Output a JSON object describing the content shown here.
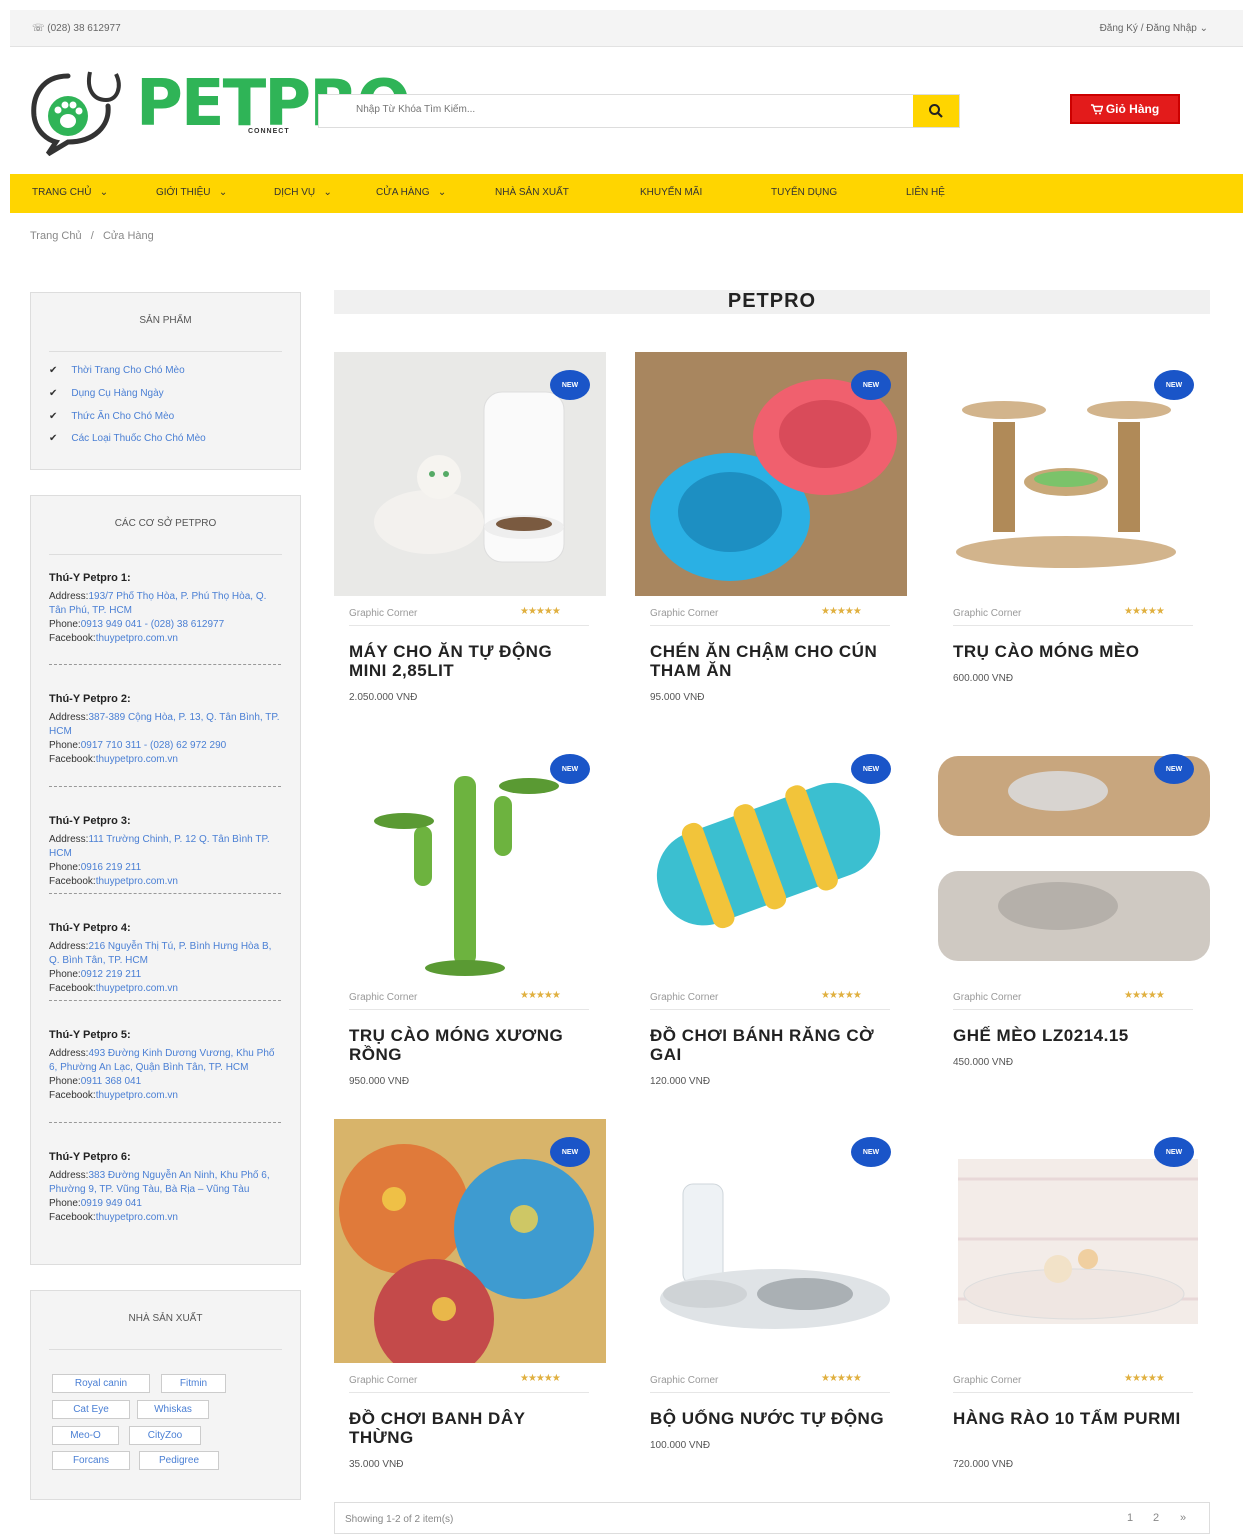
{
  "topbar": {
    "phone": "☏ (028) 38 612977",
    "auth": "Đăng Ký / Đăng Nhập ⌄"
  },
  "logo": {
    "name": "PETPRO",
    "sub": "CONNECT"
  },
  "search": {
    "placeholder": "Nhập Từ Khóa Tìm Kiếm..."
  },
  "cart": {
    "label": "Giỏ Hàng"
  },
  "nav": [
    {
      "label": "Trang Chủ",
      "dropdown": true
    },
    {
      "label": "Giới Thiệu",
      "dropdown": true
    },
    {
      "label": "Dịch Vụ",
      "dropdown": true
    },
    {
      "label": "Cửa Hàng",
      "dropdown": true
    },
    {
      "label": "Nhà Sản Xuất",
      "dropdown": false
    },
    {
      "label": "Khuyến Mãi",
      "dropdown": false
    },
    {
      "label": "Tuyển Dụng",
      "dropdown": false
    },
    {
      "label": "Liên Hệ",
      "dropdown": false
    }
  ],
  "breadcrumb": {
    "home": "Trang Chủ",
    "sep": "/",
    "current": "Cửa Hàng"
  },
  "sidebar": {
    "products_title": "Sản Phẩm",
    "categories": [
      "Thời Trang Cho Chó Mèo",
      "Dụng Cụ Hàng Ngày",
      "Thức Ăn Cho Chó Mèo",
      "Các Loại Thuốc Cho Chó Mèo"
    ],
    "branches_title": "Các Cơ Sở PETPRO",
    "labels": {
      "address": "Address:",
      "phone": "Phone:",
      "facebook": "Facebook:"
    },
    "branches": [
      {
        "name": "Thú-Y Petpro 1:",
        "address": "193/7 Phố Thọ Hòa, P. Phú Thọ Hòa, Q. Tân Phú, TP. HCM",
        "phone": "0913 949 041 - (028) 38 612977",
        "facebook": "thuypetpro.com.vn"
      },
      {
        "name": "Thú-Y Petpro 2:",
        "address": "387-389 Cộng Hòa, P. 13, Q. Tân Bình, TP. HCM",
        "phone": "0917 710 311 - (028) 62 972 290",
        "facebook": "thuypetpro.com.vn"
      },
      {
        "name": "Thú-Y Petpro 3:",
        "address": "111 Trường Chinh, P. 12 Q. Tân Bình TP. HCM",
        "phone": "0916 219 211",
        "facebook": "thuypetpro.com.vn"
      },
      {
        "name": "Thú-Y Petpro 4:",
        "address": "216 Nguyễn Thị Tú, P. Bình Hưng Hòa B, Q. Bình Tân, TP. HCM",
        "phone": "0912 219 211",
        "facebook": "thuypetpro.com.vn"
      },
      {
        "name": "Thú-Y Petpro 5:",
        "address": "493 Đường Kinh Dương Vương, Khu Phố 6, Phường An Lạc, Quận Bình Tân, TP. HCM",
        "phone": "0911 368 041",
        "facebook": "thuypetpro.com.vn"
      },
      {
        "name": "Thú-Y Petpro 6:",
        "address": "383 Đường Nguyễn An Ninh, Khu Phố 6, Phường 9, TP. Vũng Tàu, Bà Rịa – Vũng Tàu",
        "phone": "0919 949 041",
        "facebook": "thuypetpro.com.vn"
      }
    ],
    "makers_title": "Nhà Sản Xuất",
    "makers": [
      "Royal canin",
      "Fitmin",
      "Cat Eye",
      "Whiskas",
      "Meo-O",
      "CityZoo",
      "Forcans",
      "Pedigree"
    ]
  },
  "main": {
    "heading": "PETPRO",
    "badge": "NEW",
    "brand": "Graphic Corner",
    "stars": "★★★★★",
    "products": [
      {
        "name": "Máy Cho Ăn Tự Động Mini 2,85lit",
        "price": "2.050.000 VNĐ"
      },
      {
        "name": "Chén Ăn Chậm Cho Cún Tham Ăn",
        "price": "95.000 VNĐ"
      },
      {
        "name": "Trụ Cào Móng Mèo",
        "price": "600.000 VNĐ"
      },
      {
        "name": "Trụ Cào Móng Xương Rồng",
        "price": "950.000 VNĐ"
      },
      {
        "name": "Đồ Chơi Bánh Răng Cờ Gai",
        "price": "120.000 VNĐ"
      },
      {
        "name": "Ghế Mèo LZ0214.15",
        "price": "450.000 VNĐ"
      },
      {
        "name": "Đồ Chơi Banh Dây Thừng",
        "price": "35.000 VNĐ"
      },
      {
        "name": "Bộ Uống Nước Tự Động",
        "price": "100.000 VNĐ"
      },
      {
        "name": "Hàng Rào 10 Tấm Purmi",
        "price": "720.000 VNĐ"
      }
    ],
    "showing": "Showing 1-2 of 2 item(s)",
    "pages": [
      "1",
      "2",
      "»"
    ]
  },
  "colors": {
    "accent": "#ffd500",
    "brand_green": "#2fb457",
    "cart_red": "#e31b1b",
    "link_blue": "#4a7fd4",
    "badge_blue": "#1a55c8"
  }
}
